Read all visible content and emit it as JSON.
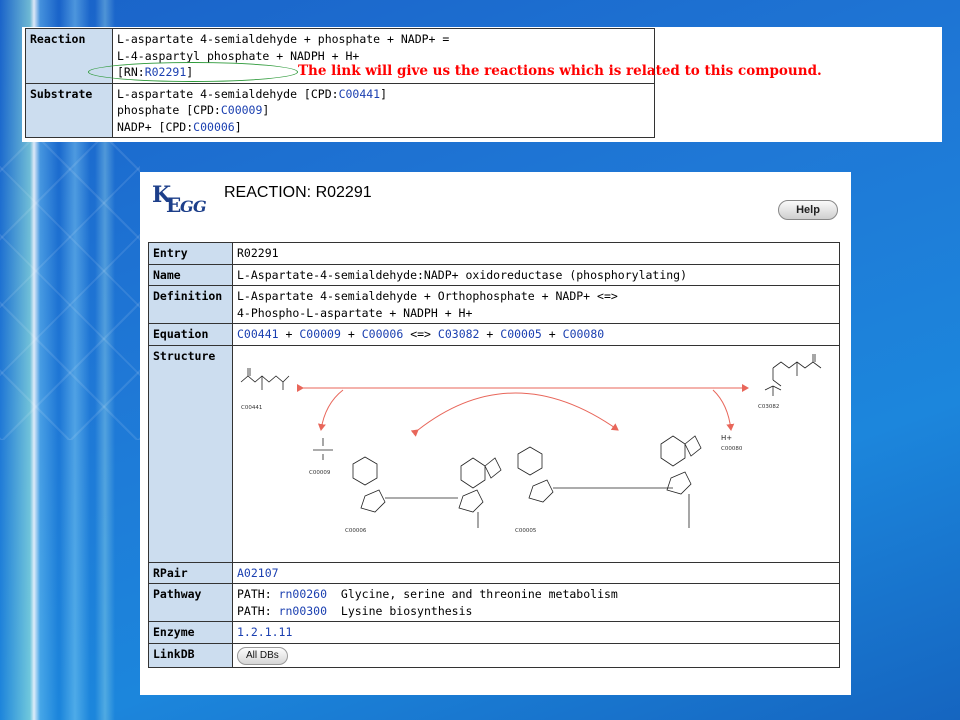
{
  "top_table": {
    "reaction_label": "Reaction",
    "reaction_line1": "L-aspartate 4-semialdehyde + phosphate + NADP+ =",
    "reaction_line2": "L-4-aspartyl phosphate + NADPH + H+",
    "rn_prefix": "[RN:",
    "rn_link": "R02291",
    "rn_suffix": "]",
    "substrate_label": "Substrate",
    "substrates": [
      {
        "text": "L-aspartate 4-semialdehyde [CPD:",
        "link": "C00441",
        "suffix": "]"
      },
      {
        "text": "phosphate [CPD:",
        "link": "C00009",
        "suffix": "]"
      },
      {
        "text": "NADP+ [CPD:",
        "link": "C00006",
        "suffix": "]"
      }
    ]
  },
  "annotation": "The link will give us the reactions which is related to this compound.",
  "kegg_page": {
    "logo_text": "KEGG",
    "title": "REACTION: R02291",
    "help_label": "Help",
    "entry_label": "Entry",
    "entry_value": "R02291",
    "name_label": "Name",
    "name_value": "L-Aspartate-4-semialdehyde:NADP+ oxidoreductase (phosphorylating)",
    "definition_label": "Definition",
    "definition_line1": "L-Aspartate 4-semialdehyde + Orthophosphate + NADP+ <=>",
    "definition_line2": "4-Phospho-L-aspartate + NADPH + H+",
    "equation_label": "Equation",
    "equation": {
      "c1": "C00441",
      "c2": "C00009",
      "c3": "C00006",
      "c4": "C03082",
      "c5": "C00005",
      "c6": "C00080",
      "plus": "+",
      "arrow": "<=>"
    },
    "structure_label": "Structure",
    "structure_captions": {
      "c00441": "C00441",
      "c00009": "C00009",
      "c00006": "C00006",
      "c00005": "C00005",
      "c00080": "C00080",
      "c03082": "C03082",
      "h_plus": "H+"
    },
    "rpair_label": "RPair",
    "rpair_value": "A02107",
    "pathway_label": "Pathway",
    "pathways": [
      {
        "prefix": "PATH:",
        "link": "rn00260",
        "name": "Glycine, serine and threonine metabolism"
      },
      {
        "prefix": "PATH:",
        "link": "rn00300",
        "name": "Lysine biosynthesis"
      }
    ],
    "enzyme_label": "Enzyme",
    "enzyme_value": "1.2.1.11",
    "linkdb_label": "LinkDB",
    "all_dbs_label": "All DBs"
  },
  "colors": {
    "background": "#1f78d6",
    "header_cell": "#ccddef",
    "link": "#1a3fb0",
    "annotation": "#ff0000",
    "highlight_ellipse": "#2e9a3a",
    "reaction_arrows": "#e8665a"
  }
}
